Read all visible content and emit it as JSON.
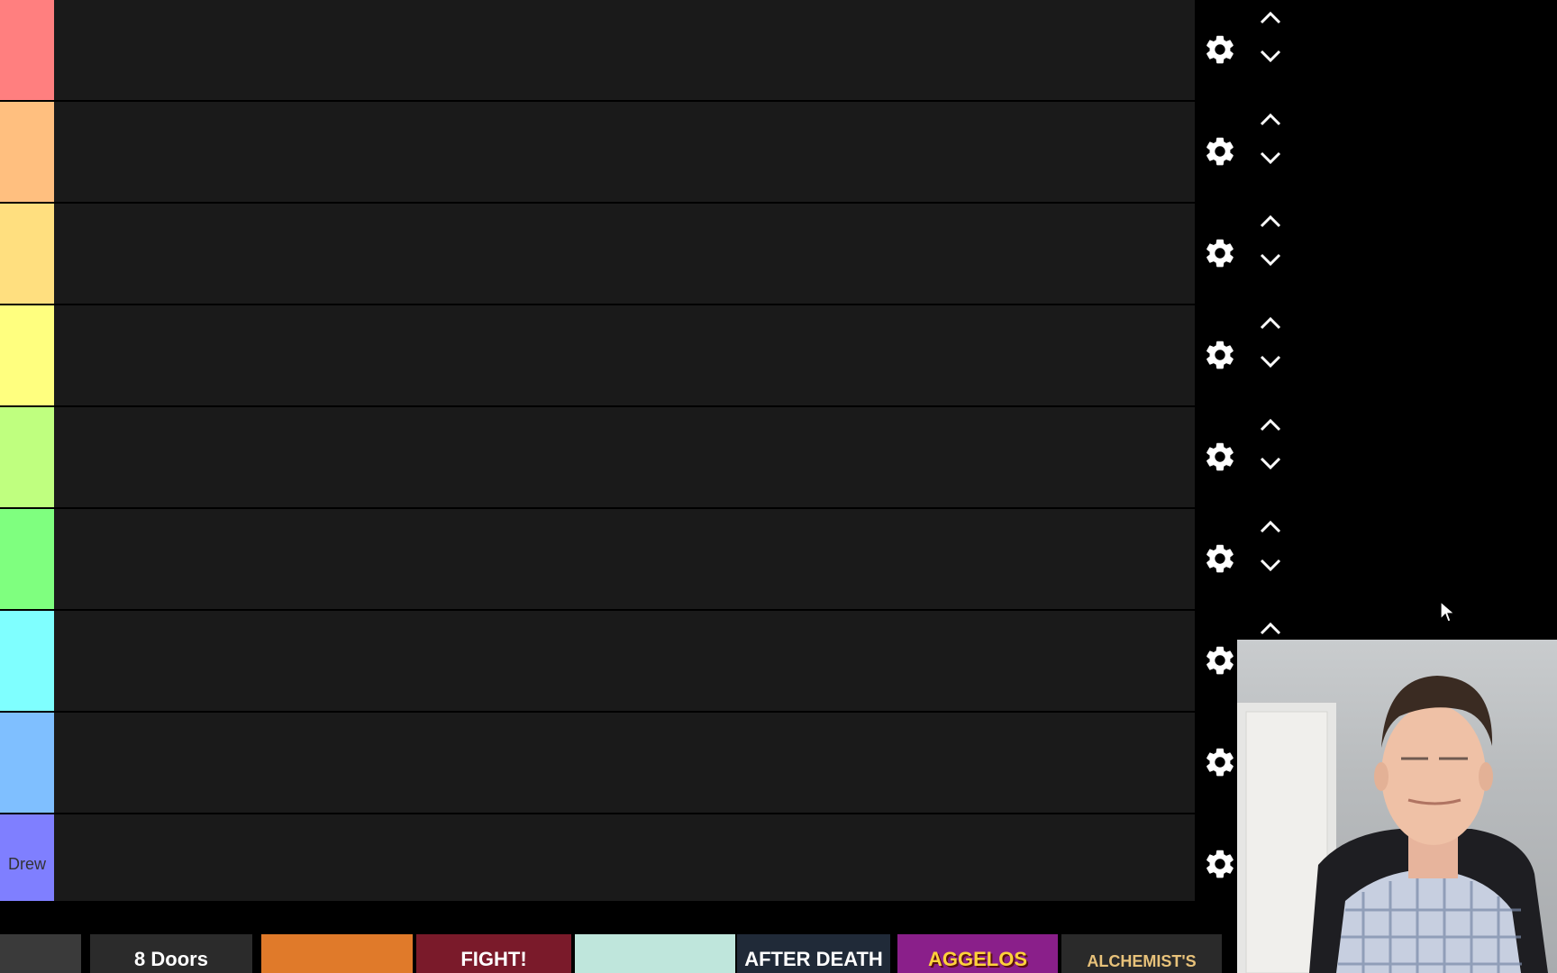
{
  "tiers": [
    {
      "label": "",
      "color": "#ff7f7f"
    },
    {
      "label": "",
      "color": "#ffbf7f"
    },
    {
      "label": "",
      "color": "#ffdf7f"
    },
    {
      "label": "",
      "color": "#ffff7f"
    },
    {
      "label": "",
      "color": "#bfff7f"
    },
    {
      "label": "",
      "color": "#7fff7f"
    },
    {
      "label": "",
      "color": "#7fffff"
    },
    {
      "label": "",
      "color": "#7fbfff"
    },
    {
      "label": "Drew",
      "color": "#7f7fff"
    }
  ],
  "controls": {
    "icon_settings": "gear-icon",
    "icon_up": "chevron-up-icon",
    "icon_down": "chevron-down-icon"
  },
  "pool": {
    "items": [
      {
        "text": "",
        "bg": "#3a3a3a"
      },
      {
        "text": "8 Doors",
        "bg": "#2b2b2b"
      },
      {
        "text": "",
        "bg": "#e07a2a"
      },
      {
        "text": "FIGHT!",
        "bg": "#7a1a2a"
      },
      {
        "text": "",
        "bg": "#bfe6dc"
      },
      {
        "text": "AFTER DEATH",
        "bg": "#202a38"
      },
      {
        "text": "AGGELOS",
        "bg": "#8a1f8a"
      },
      {
        "text": "ALCHEMIST'S",
        "bg": "#2a2a2a"
      }
    ]
  },
  "webcam": {
    "icon": "webcam-person"
  },
  "colors": {
    "row_bg": "#1a1a1a",
    "page_bg": "#000000",
    "icon": "#ffffff"
  }
}
